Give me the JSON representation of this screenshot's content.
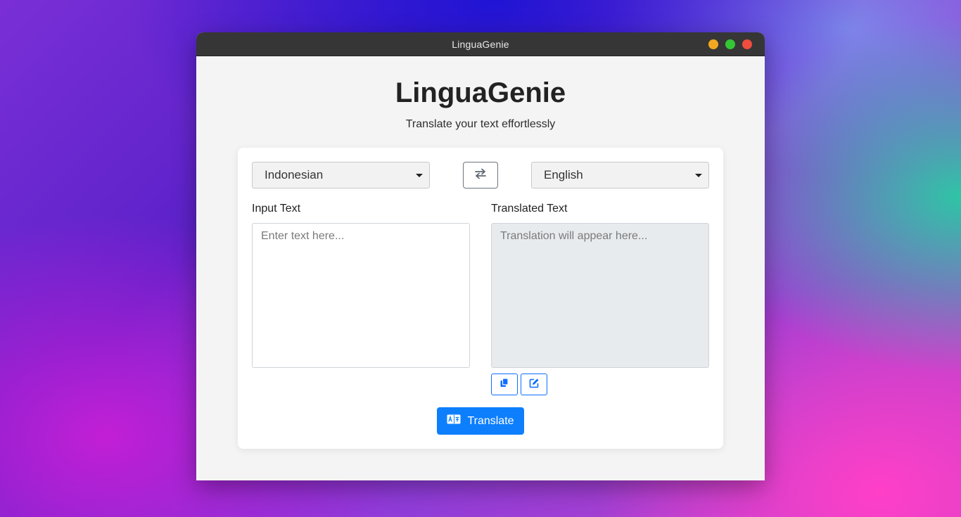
{
  "window": {
    "title": "LinguaGenie"
  },
  "header": {
    "title": "LinguaGenie",
    "subtitle": "Translate your text effortlessly"
  },
  "languages": {
    "source": "Indonesian",
    "target": "English"
  },
  "input": {
    "label": "Input Text",
    "placeholder": "Enter text here..."
  },
  "output": {
    "label": "Translated Text",
    "placeholder": "Translation will appear here..."
  },
  "actions": {
    "translate_label": "Translate"
  },
  "colors": {
    "accent": "#0d7ffd",
    "titlebar": "#363636",
    "minimize": "#f2a922",
    "maximize": "#35c634",
    "close": "#ef4d3f"
  },
  "icons": {
    "swap": "swap-arrows-icon",
    "copy": "copy-icon",
    "edit": "edit-icon",
    "translate": "translate-icon"
  }
}
